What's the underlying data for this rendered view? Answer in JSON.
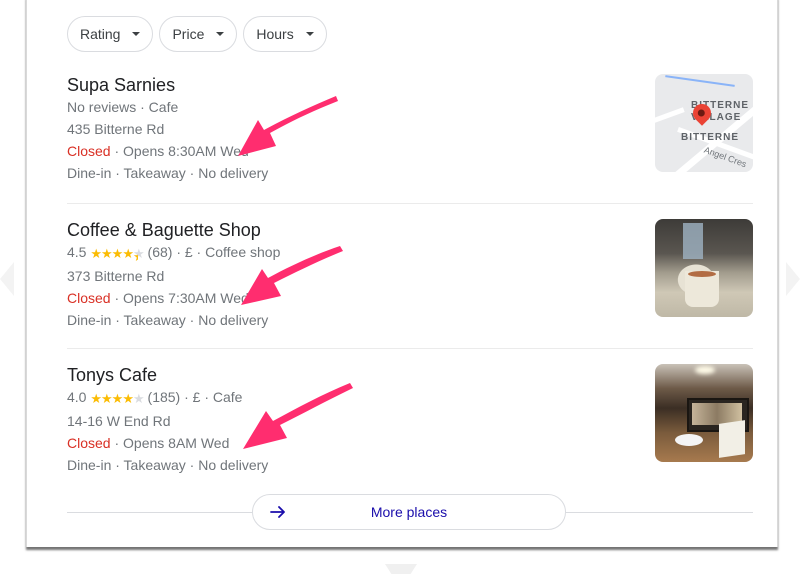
{
  "filters": [
    {
      "label": "Rating",
      "icon": "caret-down-icon"
    },
    {
      "label": "Price",
      "icon": "caret-down-icon"
    },
    {
      "label": "Hours",
      "icon": "caret-down-icon"
    }
  ],
  "results": [
    {
      "name": "Supa Sarnies",
      "meta": "No reviews · Cafe",
      "address": "435 Bitterne Rd",
      "status": "Closed",
      "hours": " · Opens 8:30AM Wed",
      "services": "Dine-in · Takeaway · No delivery",
      "thumbnail": "map-thumbnail",
      "map_labels": {
        "village_1": "BITTERNE",
        "village_2": "VILLAGE",
        "area": "BITTERNE",
        "street": "Angel Cres"
      }
    },
    {
      "name": "Coffee & Baguette Shop",
      "rating": "4.5",
      "rating_value": 4.5,
      "reviews": "(68)",
      "price_type": " · £ · Coffee shop",
      "address": "373 Bitterne Rd",
      "status": "Closed",
      "hours": " · Opens 7:30AM Wed",
      "services": "Dine-in · Takeaway · No delivery",
      "thumbnail": "coffee-cup-photo"
    },
    {
      "name": "Tonys Cafe",
      "rating": "4.0",
      "rating_value": 4.0,
      "reviews": "(185)",
      "price_type": " · £ · Cafe",
      "address": "14-16 W End Rd",
      "status": "Closed",
      "hours": " · Opens 8AM Wed",
      "services": "Dine-in · Takeaway · No delivery",
      "thumbnail": "cafe-interior-photo"
    }
  ],
  "more_places": {
    "label": "More places",
    "icon": "arrow-right-icon"
  },
  "colors": {
    "closed": "#d93025",
    "star": "#fbbc04",
    "link": "#1a0dab",
    "annotation_arrow": "#ff2d6f"
  },
  "annotations": [
    {
      "type": "arrow",
      "points_to": "Supa Sarnies opening hours"
    },
    {
      "type": "arrow",
      "points_to": "Coffee & Baguette Shop opening hours"
    },
    {
      "type": "arrow",
      "points_to": "Tonys Cafe opening hours"
    }
  ]
}
